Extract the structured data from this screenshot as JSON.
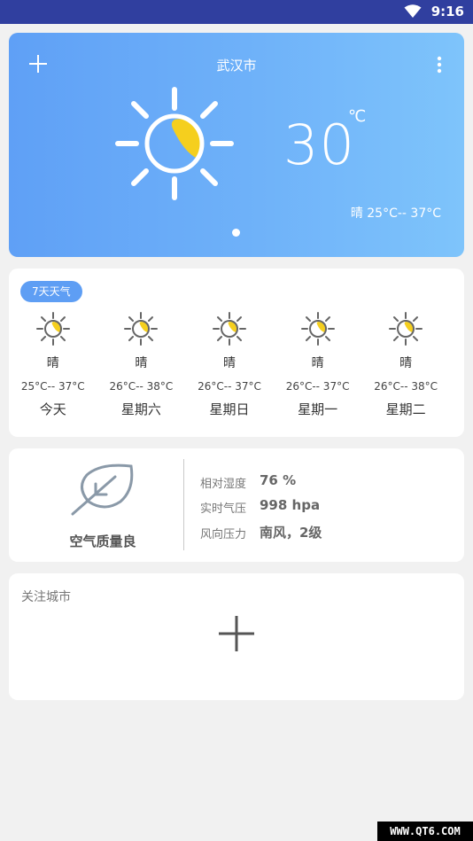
{
  "status_bar": {
    "time": "9:16"
  },
  "header": {
    "city": "武汉市",
    "temperature": "30",
    "unit": "℃",
    "condition_range": "晴 25°C-- 37°C"
  },
  "forecast": {
    "badge": "7天天气",
    "days": [
      {
        "condition": "晴",
        "range": "25°C-- 37°C",
        "name": "今天"
      },
      {
        "condition": "晴",
        "range": "26°C-- 38°C",
        "name": "星期六"
      },
      {
        "condition": "晴",
        "range": "26°C-- 37°C",
        "name": "星期日"
      },
      {
        "condition": "晴",
        "range": "26°C-- 37°C",
        "name": "星期一"
      },
      {
        "condition": "晴",
        "range": "26°C-- 38°C",
        "name": "星期二"
      }
    ]
  },
  "air": {
    "quality": "空气质量良",
    "rows": [
      {
        "label": "相对湿度",
        "value": "76 %"
      },
      {
        "label": "实时气压",
        "value": "998 hpa"
      },
      {
        "label": "风向压力",
        "value": "南风，2级"
      }
    ]
  },
  "follow": {
    "title": "关注城市"
  },
  "watermark": "WWW.QT6.COM",
  "colors": {
    "accent": "#5e9ef4",
    "sun": "#f5cf1e"
  },
  "icons": [
    "wifi-icon",
    "add-icon",
    "more-vertical-icon",
    "sun-icon",
    "leaf-icon"
  ]
}
